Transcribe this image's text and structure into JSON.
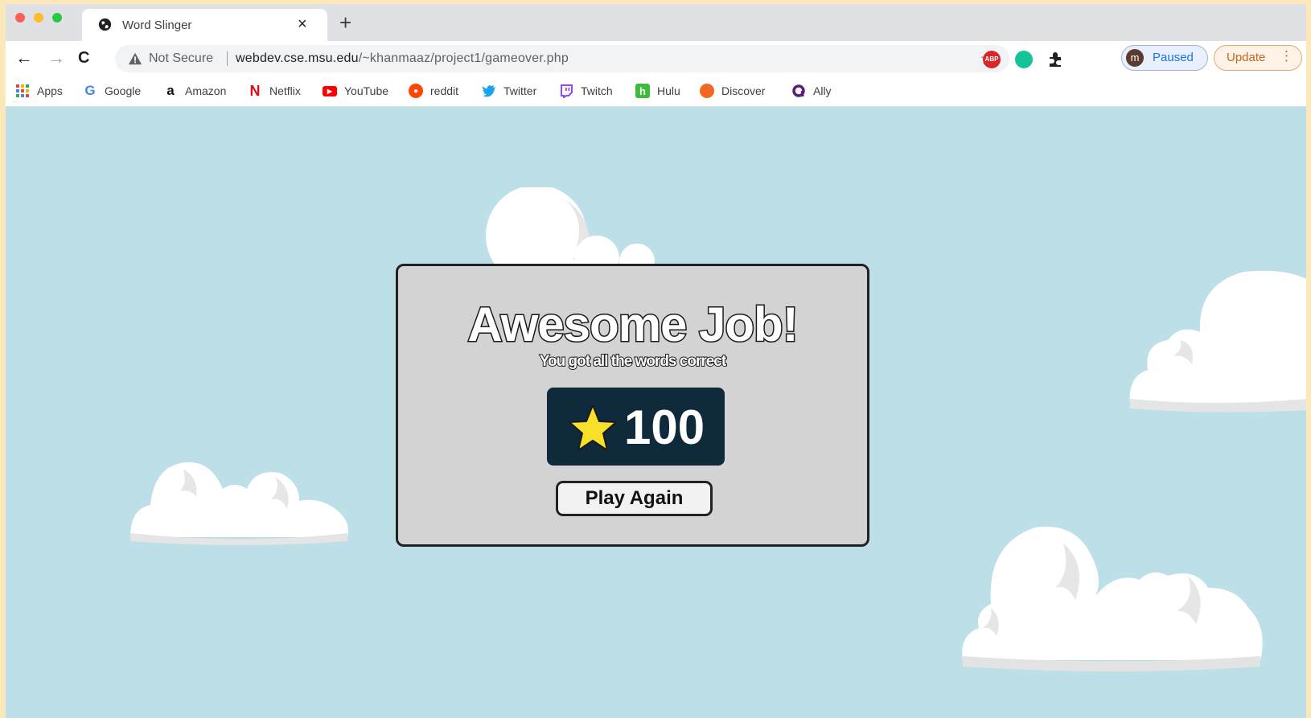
{
  "browser": {
    "tab": {
      "title": "Word Slinger",
      "close_glyph": "×",
      "new_tab_glyph": "+"
    },
    "nav": {
      "back_glyph": "←",
      "forward_glyph": "→",
      "reload_glyph": "C"
    },
    "address_bar": {
      "security_label": "Not Secure",
      "url_host": "webdev.cse.msu.edu",
      "url_path": "/~khanmaaz/project1/gameover.php",
      "bookmark_star": "☆"
    },
    "profile": {
      "initial": "m",
      "label": "Paused"
    },
    "update": {
      "label": "Update",
      "menu_glyph": "⋮"
    },
    "bookmarks": [
      {
        "label": "Apps",
        "icon": "apps-grid-icon"
      },
      {
        "label": "Google",
        "icon": "google-icon"
      },
      {
        "label": "Amazon",
        "icon": "amazon-icon"
      },
      {
        "label": "Netflix",
        "icon": "netflix-icon"
      },
      {
        "label": "YouTube",
        "icon": "youtube-icon"
      },
      {
        "label": "reddit",
        "icon": "reddit-icon"
      },
      {
        "label": "Twitter",
        "icon": "twitter-icon"
      },
      {
        "label": "Twitch",
        "icon": "twitch-icon"
      },
      {
        "label": "Hulu",
        "icon": "hulu-icon"
      },
      {
        "label": "Discover",
        "icon": "discover-icon"
      },
      {
        "label": "Ally",
        "icon": "ally-icon"
      }
    ]
  },
  "game": {
    "headline": "Awesome Job!",
    "subtitle": "You got all the words correct",
    "score": "100",
    "play_again_label": "Play Again"
  },
  "colors": {
    "sky": "#bddfe8",
    "score_box": "#0f2a3a",
    "star": "#f7e02a",
    "card": "#d3d3d3"
  }
}
